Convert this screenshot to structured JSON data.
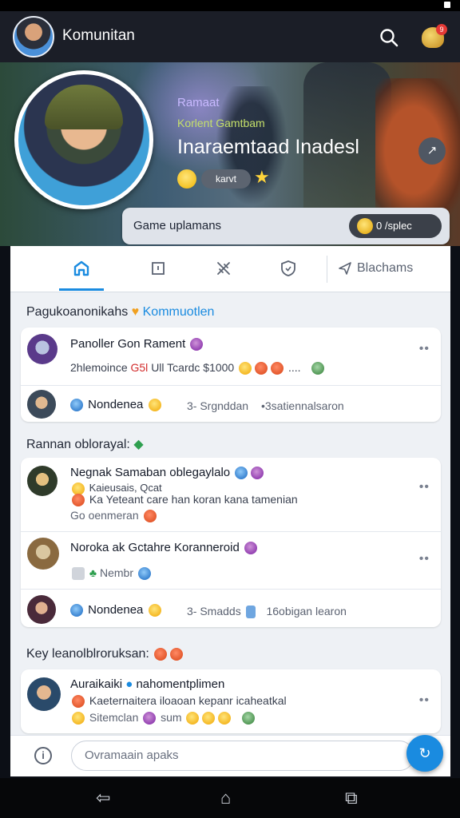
{
  "app_bar": {
    "title": "Komunitan",
    "notification_count": "9"
  },
  "hero": {
    "subtitle_1": "Ramaat",
    "subtitle_2": "Korlent Gamtbam",
    "headline": "Inaraemtaad Inadesl",
    "chip_label": "karvt",
    "share_icon": "↗"
  },
  "banner": {
    "label": "Game uplamans",
    "pill_label": "0 /splec"
  },
  "tabs": [
    {
      "name": "home-icon",
      "label": ""
    },
    {
      "name": "bookmark-icon",
      "label": ""
    },
    {
      "name": "sword-icon",
      "label": ""
    },
    {
      "name": "shield-icon",
      "label": ""
    },
    {
      "name": "send-icon",
      "label": "Blachams"
    }
  ],
  "sections": {
    "first_title": "Pagukoanonikahs",
    "first_accent": "Kommuotlen",
    "second_title": "Rannan oblorayal:",
    "third_title": "Key leanolblroruksan:"
  },
  "posts": [
    {
      "name": "Panoller Gon Rament",
      "meta": "2hlemoince",
      "meta_red": "G5l",
      "meta_rest": "Ull Tcardc $1000",
      "ellipsis": "....",
      "more": "••"
    },
    {
      "name": "Nondenea",
      "meta": "3- Srgnddan",
      "meta_rest": "•3satiennalsaron"
    },
    {
      "name": "Negnak Samaban oblegaylalo",
      "line_1": "Kaieusais, Qcat",
      "line_2": "Ka Yeteant care han koran kana tamenian",
      "line_3": "Go oenmeran",
      "more": "••"
    },
    {
      "name": "Noroka ak Gctahre Koranneroid",
      "meta": "Nembr",
      "more": "••"
    },
    {
      "name": "Nondenea",
      "meta": "3- Smadds",
      "meta_rest": "16obigan learon"
    },
    {
      "name": "Auraikaiki",
      "name_rest": "nahomentplimen",
      "line_1": "Kaeternaitera iloaoan kepanr icaheatkal",
      "line_2": "Sitemclan",
      "line_2b": "sum",
      "more": "••"
    }
  ],
  "composer": {
    "placeholder": "Ovramaain apaks",
    "info_icon": "i",
    "fab_icon": "↻"
  },
  "navigation": {
    "back": "⇦",
    "home": "⌂",
    "recents": "⧉"
  }
}
